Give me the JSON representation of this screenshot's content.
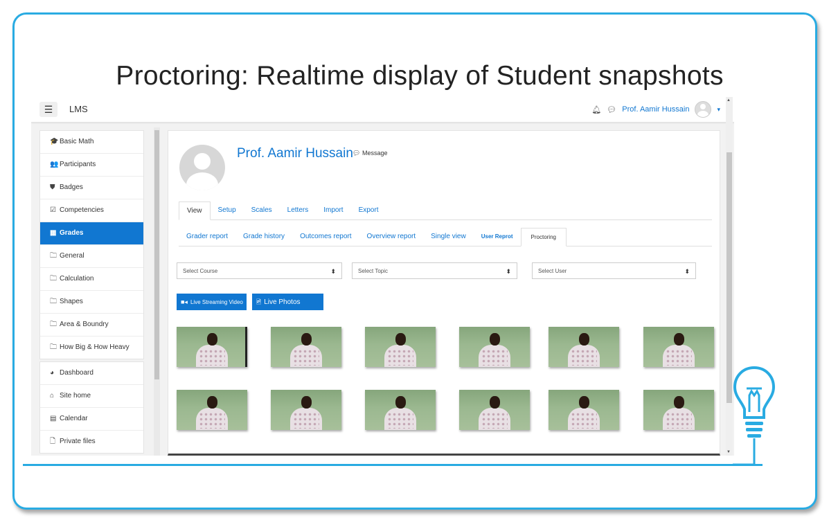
{
  "slide": {
    "title": "Proctoring: Realtime display of Student snapshots",
    "accent_color": "#29abe2",
    "bulb_icon": "lightbulb-icon"
  },
  "navbar": {
    "menu_icon": "hamburger-icon",
    "brand": "LMS",
    "bell_icon": "bell-icon",
    "chat_icon": "chat-icon",
    "user_name": "Prof. Aamir Hussain",
    "caret": "▾"
  },
  "sidebar": {
    "course_items": [
      {
        "label": "Basic Math",
        "icon": "graduation-cap-icon",
        "glyph": "🎓"
      },
      {
        "label": "Participants",
        "icon": "users-icon",
        "glyph": "👥"
      },
      {
        "label": "Badges",
        "icon": "shield-icon",
        "glyph": "⛊"
      },
      {
        "label": "Competencies",
        "icon": "checkbox-icon",
        "glyph": "☑"
      },
      {
        "label": "Grades",
        "icon": "table-icon",
        "glyph": "▦",
        "active": true
      },
      {
        "label": "General",
        "icon": "folder-icon",
        "glyph": "🗀"
      },
      {
        "label": "Calculation",
        "icon": "folder-icon",
        "glyph": "🗀"
      },
      {
        "label": "Shapes",
        "icon": "folder-icon",
        "glyph": "🗀"
      },
      {
        "label": "Area & Boundry",
        "icon": "folder-icon",
        "glyph": "🗀"
      },
      {
        "label": "How Big & How Heavy",
        "icon": "folder-icon",
        "glyph": "🗀"
      }
    ],
    "site_items": [
      {
        "label": "Dashboard",
        "icon": "dashboard-icon",
        "glyph": "◕"
      },
      {
        "label": "Site home",
        "icon": "home-icon",
        "glyph": "⌂"
      },
      {
        "label": "Calendar",
        "icon": "calendar-icon",
        "glyph": "▤"
      },
      {
        "label": "Private files",
        "icon": "file-icon",
        "glyph": "🗋"
      }
    ]
  },
  "profile": {
    "name": "Prof. Aamir Hussain",
    "message_label": "Message"
  },
  "tabs_primary": [
    {
      "label": "View",
      "active": true
    },
    {
      "label": "Setup"
    },
    {
      "label": "Scales"
    },
    {
      "label": "Letters"
    },
    {
      "label": "Import"
    },
    {
      "label": "Export"
    }
  ],
  "tabs_secondary": [
    {
      "label": "Grader report"
    },
    {
      "label": "Grade history"
    },
    {
      "label": "Outcomes report"
    },
    {
      "label": "Overview report"
    },
    {
      "label": "Single view"
    },
    {
      "label": "User Reprot",
      "small": true
    },
    {
      "label": "Proctoring",
      "active": true
    }
  ],
  "filters": {
    "course": "Select Course",
    "topic": "Select Topic",
    "user": "Select User",
    "arrow": "⬍"
  },
  "buttons": {
    "live_video": "Live Streaming Video",
    "live_photos": "Live Photos"
  },
  "snapshots": {
    "rows": 2,
    "cols": 6
  }
}
